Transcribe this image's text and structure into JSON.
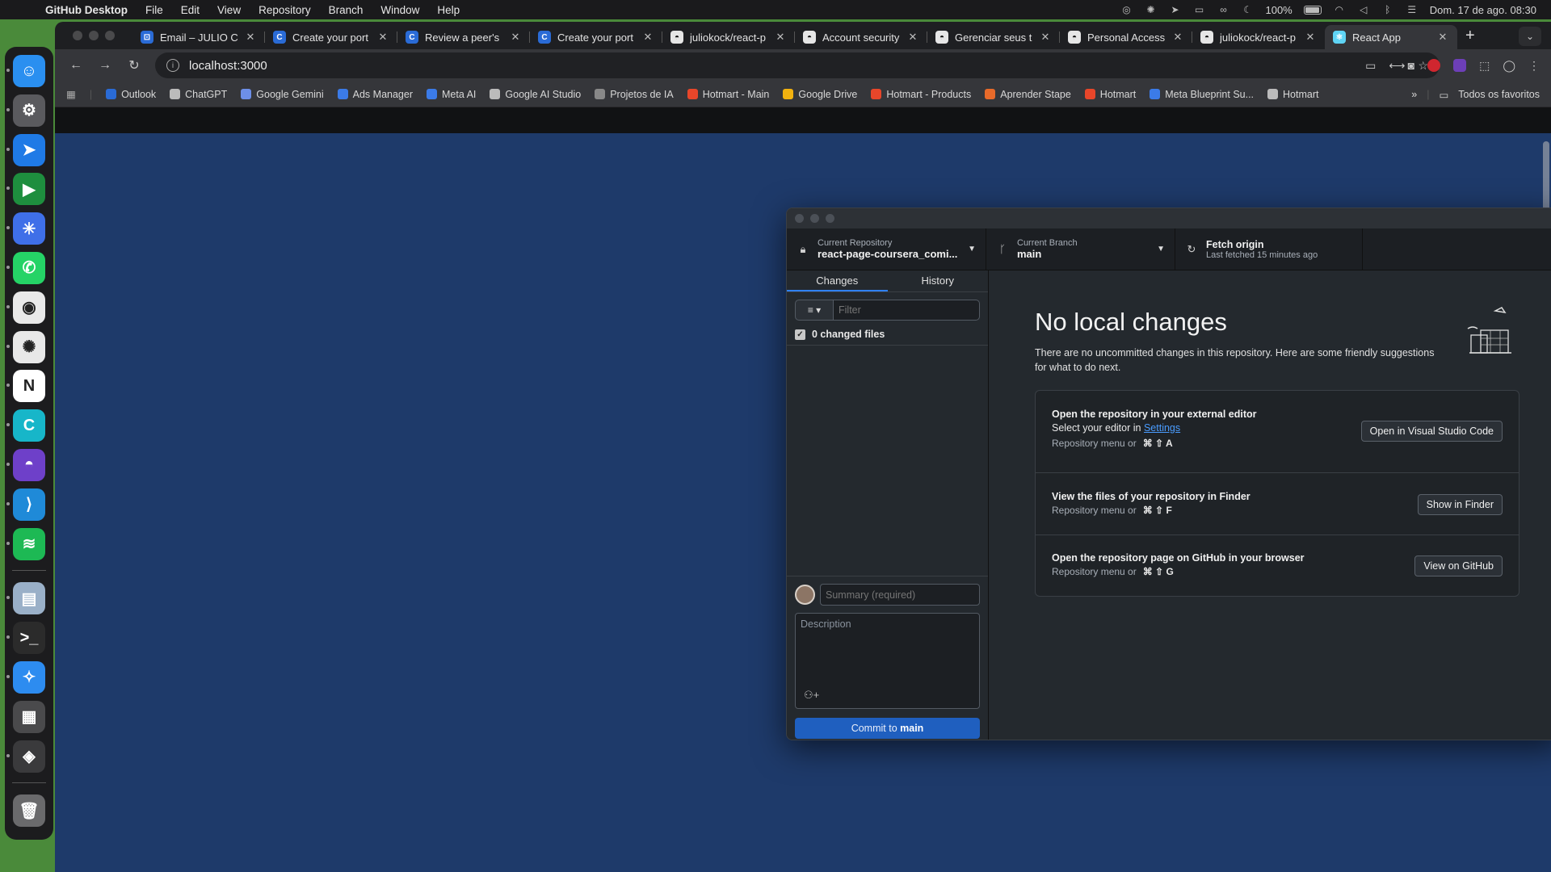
{
  "menubar": {
    "app_name": "GitHub Desktop",
    "menus": [
      "File",
      "Edit",
      "View",
      "Repository",
      "Branch",
      "Window",
      "Help"
    ],
    "battery": "100%",
    "datetime": "Dom. 17 de ago. 08:30"
  },
  "dock": {
    "apps": [
      {
        "name": "finder",
        "bg": "#2a8ff0",
        "glyph": "☺"
      },
      {
        "name": "system-settings",
        "bg": "#5a5a5e",
        "glyph": "⚙"
      },
      {
        "name": "paper-plane-app",
        "bg": "#1f7ae6",
        "glyph": "➤"
      },
      {
        "name": "google-meet",
        "bg": "#1e8e3e",
        "glyph": "▶"
      },
      {
        "name": "ai-app",
        "bg": "#3f6fe8",
        "glyph": "✳"
      },
      {
        "name": "whatsapp",
        "bg": "#25d366",
        "glyph": "✆"
      },
      {
        "name": "chrome",
        "bg": "#e9e9e9",
        "glyph": "◉"
      },
      {
        "name": "chatgpt",
        "bg": "#e8e8e8",
        "glyph": "✺"
      },
      {
        "name": "notion",
        "bg": "#ffffff",
        "glyph": "N"
      },
      {
        "name": "canva",
        "bg": "#17b6c9",
        "glyph": "C"
      },
      {
        "name": "github-desktop",
        "bg": "#6e40c9",
        "glyph": "◓"
      },
      {
        "name": "vscode",
        "bg": "#1f8ad8",
        "glyph": "⟩"
      },
      {
        "name": "spotify",
        "bg": "#1db954",
        "glyph": "≋"
      }
    ],
    "apps_after": [
      {
        "name": "preview",
        "bg": "#9ab0c8",
        "glyph": "▤"
      },
      {
        "name": "terminal",
        "bg": "#2b2b2b",
        "glyph": ">_"
      },
      {
        "name": "safari",
        "bg": "#2d8cf0",
        "glyph": "✧"
      },
      {
        "name": "calculator",
        "bg": "#4a4a4c",
        "glyph": "▦"
      },
      {
        "name": "unity",
        "bg": "#3a3a3c",
        "glyph": "◈"
      },
      {
        "name": "trash",
        "bg": "#6a6a6c",
        "glyph": "🗑"
      }
    ]
  },
  "browser": {
    "tabs": [
      {
        "title": "Email – JULIO C",
        "fav": "#2a6bd6",
        "glyph": "⊡"
      },
      {
        "title": "Create your port",
        "fav": "#2a6bd6",
        "glyph": "C"
      },
      {
        "title": "Review a peer's",
        "fav": "#2a6bd6",
        "glyph": "C"
      },
      {
        "title": "Create your port",
        "fav": "#2a6bd6",
        "glyph": "C"
      },
      {
        "title": "juliokock/react-p",
        "fav": "#e6e6e6",
        "glyph": "◓"
      },
      {
        "title": "Account security",
        "fav": "#e6e6e6",
        "glyph": "◓"
      },
      {
        "title": "Gerenciar seus t",
        "fav": "#e6e6e6",
        "glyph": "◓"
      },
      {
        "title": "Personal Access",
        "fav": "#e6e6e6",
        "glyph": "◓"
      },
      {
        "title": "juliokock/react-p",
        "fav": "#e6e6e6",
        "glyph": "◓"
      },
      {
        "title": "React App",
        "fav": "#5fd4f5",
        "glyph": "⚛"
      }
    ],
    "url": "localhost:3000",
    "bookmarks": [
      {
        "label": "Outlook",
        "color": "#2a6bd6"
      },
      {
        "label": "ChatGPT",
        "color": "#bbbbbb"
      },
      {
        "label": "Google Gemini",
        "color": "#6d8fe8"
      },
      {
        "label": "Ads Manager",
        "color": "#3b7be8"
      },
      {
        "label": "Meta AI",
        "color": "#3b7be8"
      },
      {
        "label": "Google AI Studio",
        "color": "#bbbbbb"
      },
      {
        "label": "Projetos de IA",
        "color": "#888888"
      },
      {
        "label": "Hotmart - Main",
        "color": "#e8462a"
      },
      {
        "label": "Google Drive",
        "color": "#f2b20f"
      },
      {
        "label": "Hotmart - Products",
        "color": "#e8462a"
      },
      {
        "label": "Aprender Stape",
        "color": "#e86a2a"
      },
      {
        "label": "Hotmart",
        "color": "#e8462a"
      },
      {
        "label": "Meta Blueprint Su...",
        "color": "#3b7be8"
      },
      {
        "label": "Hotmart",
        "color": "#bbbbbb"
      }
    ],
    "all_favorites": "Todos os favoritos"
  },
  "github_desktop": {
    "repo_small": "Current Repository",
    "repo_name": "react-page-coursera_comi...",
    "branch_small": "Current Branch",
    "branch_name": "main",
    "fetch_title": "Fetch origin",
    "fetch_sub": "Last fetched 15 minutes ago",
    "tab_changes": "Changes",
    "tab_history": "History",
    "filter_placeholder": "Filter",
    "changed_files": "0 changed files",
    "summary_placeholder": "Summary (required)",
    "description_placeholder": "Description",
    "commit_prefix": "Commit to",
    "commit_branch": "main",
    "heading": "No local changes",
    "subtext": "There are no uncommitted changes in this repository. Here are some friendly suggestions for what to do next.",
    "cards": [
      {
        "title": "Open the repository in your external editor",
        "line_prefix": "Select your editor in",
        "link": "Settings",
        "shortcut_prefix": "Repository menu or",
        "keys": "⌘ ⇧ A",
        "button": "Open in Visual Studio Code"
      },
      {
        "title": "View the files of your repository in Finder",
        "shortcut_prefix": "Repository menu or",
        "keys": "⌘ ⇧ F",
        "button": "Show in Finder"
      },
      {
        "title": "Open the repository page on GitHub in your browser",
        "shortcut_prefix": "Repository menu or",
        "keys": "⌘ ⇧ G",
        "button": "View on GitHub"
      }
    ]
  }
}
